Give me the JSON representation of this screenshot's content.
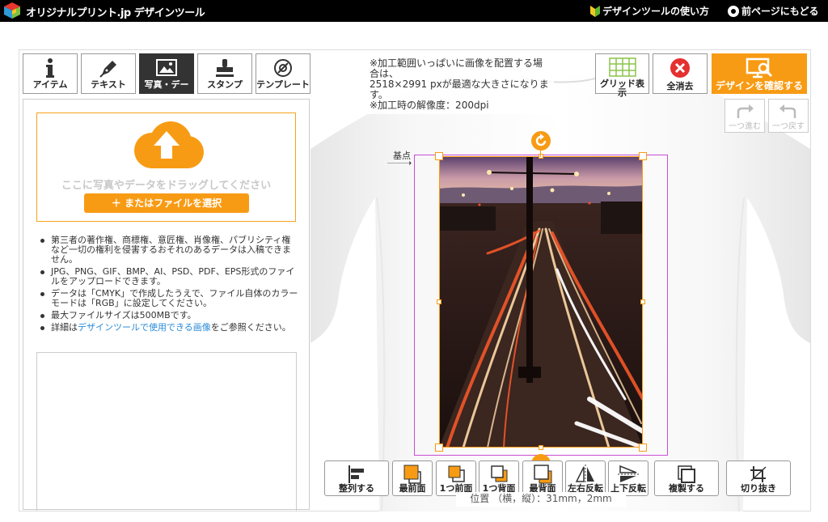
{
  "header": {
    "brand": "オリジナルプリント.jp デザインツール",
    "help_link": "デザインツールの使い方",
    "back_link": "前ページにもどる"
  },
  "tabs": [
    {
      "label": "アイテム",
      "icon": "info-icon"
    },
    {
      "label": "テキスト",
      "icon": "pen-icon"
    },
    {
      "label": "写真・デー",
      "icon": "image-icon",
      "active": true
    },
    {
      "label": "スタンプ",
      "icon": "stamp-icon"
    },
    {
      "label": "テンプレート",
      "icon": "template-icon"
    }
  ],
  "upload": {
    "drop_text": "ここに写真やデータをドラッグしてください",
    "file_button": "＋ またはファイルを選択"
  },
  "notes": {
    "n1": "第三者の著作権、商標権、意匠権、肖像権、パブリシティ権など一切の権利を侵害するおそれのあるデータは入稿できません。",
    "n2": "JPG、PNG、GIF、BMP、AI、PSD、PDF、EPS形式のファイルをアップロードできます。",
    "n3": "データは「CMYK」で作成したうえで、ファイル自体のカラーモードは「RGB」に設定してください。",
    "n4": "最大ファイルサイズは500MBです。",
    "n5_pre": "詳細は",
    "n5_link": "デザインツールで使用できる画像",
    "n5_post": "をご参照ください。"
  },
  "hint": {
    "line1": "※加工範囲いっぱいに画像を配置する場合は、",
    "line2": "2518×2991 pxが最適な大きさになります。",
    "line3": "※加工時の解像度：200dpi"
  },
  "toolbar": {
    "grid": "グリッド表示",
    "clear": "全消去",
    "confirm": "デザインを確認する",
    "redo": "一つ進む",
    "undo": "一つ戻す"
  },
  "canvas": {
    "origin_label": "基点",
    "origin_arrow": "→"
  },
  "bottom_tools": {
    "align": "整列する",
    "front": "最前面",
    "forward": "1つ前面",
    "backward": "1つ背面",
    "back": "最背面",
    "flip_h": "左右反転",
    "flip_v": "上下反転",
    "duplicate": "複製する",
    "crop": "切り抜き"
  },
  "status": {
    "position": "位置 （横，縦）：31mm，2mm"
  },
  "colors": {
    "accent": "#f89b14",
    "print_area": "#c84ed4",
    "link": "#2a8bd8"
  }
}
